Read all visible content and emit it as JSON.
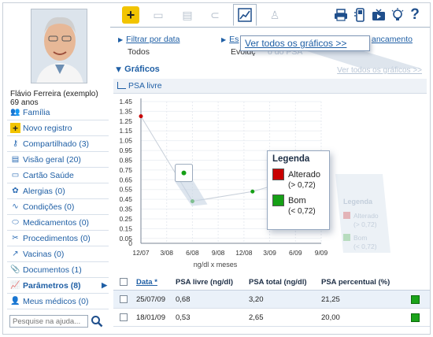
{
  "patient": {
    "name": "Flávio Ferreira (exemplo)",
    "age": "69 anos"
  },
  "sidebar": {
    "items": [
      {
        "label": "Família",
        "icon": "family-icon"
      },
      {
        "label": "Novo registro",
        "icon": "plus-icon"
      },
      {
        "label": "Compartilhado (3)",
        "icon": "key-icon"
      },
      {
        "label": "Visão geral (20)",
        "icon": "overview-icon"
      },
      {
        "label": "Cartão Saúde",
        "icon": "card-icon"
      },
      {
        "label": "Alergias (0)",
        "icon": "allergy-icon"
      },
      {
        "label": "Condições (0)",
        "icon": "stethoscope-icon"
      },
      {
        "label": "Medicamentos (0)",
        "icon": "pill-icon"
      },
      {
        "label": "Procedimentos (0)",
        "icon": "procedure-icon"
      },
      {
        "label": "Vacinas (0)",
        "icon": "syringe-icon"
      },
      {
        "label": "Documentos (1)",
        "icon": "clip-icon"
      },
      {
        "label": "Parâmetros (8)",
        "icon": "parameters-icon"
      },
      {
        "label": "Meus médicos (0)",
        "icon": "doctor-icon"
      }
    ],
    "search_placeholder": "Pesquise na ajuda..."
  },
  "toolbar": {
    "tooltip": "Ver todos os gráficos >>"
  },
  "filters": {
    "filter_link": "Filtrar por data",
    "filter_value": "Todos",
    "second_link_visible": "Es",
    "second_link_tail": "ancamento",
    "second_value": "Evoluç",
    "second_value_tail": "o do PSA"
  },
  "graphs": {
    "section_title": "Gráficos",
    "see_all": "Ver todos os gráficos >>",
    "subheader": "PSA livre"
  },
  "chart_data": {
    "type": "scatter",
    "title": "PSA livre",
    "xlabel": "ng/dl x meses",
    "ylabel": "",
    "ylim": [
      0,
      1.45
    ],
    "y_ticks": [
      "1.45",
      "1.35",
      "1.25",
      "1.15",
      "1.05",
      "0.95",
      "0.85",
      "0.75",
      "0.65",
      "0.55",
      "0.45",
      "0.35",
      "0.25",
      "0.15",
      "0.05",
      "0"
    ],
    "x_ticks": [
      "12/07",
      "3/08",
      "6/08",
      "9/08",
      "12/08",
      "3/09",
      "6/09",
      "9/09"
    ],
    "grid": true,
    "points": [
      {
        "x": "12/07",
        "y": 1.3,
        "status": "Alterado"
      },
      {
        "x": "6/08",
        "y": 0.43,
        "status": "Bom"
      },
      {
        "x": "1/09",
        "y": 0.53,
        "status": "Bom"
      },
      {
        "x": "7/09",
        "y": 0.68,
        "status": "Bom"
      }
    ],
    "highlight_point": {
      "x": "5/08",
      "y": 0.72
    },
    "legend": {
      "title": "Legenda",
      "entries": [
        {
          "label": "Alterado",
          "range": "(> 0,72)",
          "color": "#c80000"
        },
        {
          "label": "Bom",
          "range": "(< 0,72)",
          "color": "#16a016"
        }
      ]
    }
  },
  "table": {
    "headers": [
      "Data *",
      "PSA livre (ng/dl)",
      "PSA total (ng/dl)",
      "PSA percentual (%)"
    ],
    "rows": [
      {
        "date": "25/07/09",
        "psa_livre": "0,68",
        "psa_total": "3,20",
        "psa_pct": "21,25"
      },
      {
        "date": "18/01/09",
        "psa_livre": "0,53",
        "psa_total": "2,65",
        "psa_pct": "20,00"
      }
    ]
  },
  "colors": {
    "accent": "#1f5fa5",
    "alterado": "#c80000",
    "bom": "#16a016"
  }
}
